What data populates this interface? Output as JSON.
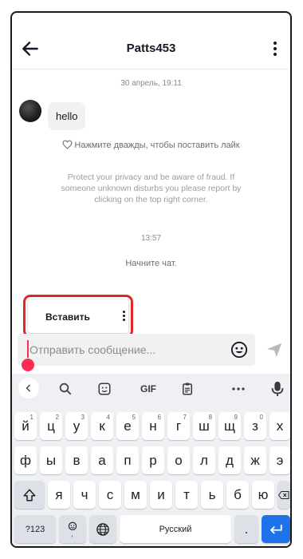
{
  "header": {
    "title": "Patts453"
  },
  "chat": {
    "timestamp_1": "30 апрель, 19:11",
    "message_1": "hello",
    "like_hint": "Нажмите дважды, чтобы поставить лайк",
    "privacy_notice": "Protect your privacy and be aware of fraud. If someone unknown disturbs you please report by clicking on the top right corner.",
    "timestamp_2": "13:57",
    "start_chat": "Начните чат."
  },
  "context_menu": {
    "paste_label": "Вставить"
  },
  "composer": {
    "placeholder": "Отправить сообщение..."
  },
  "keyboard": {
    "toolbar": {
      "gif_label": "GIF"
    },
    "row1": [
      {
        "k": "й",
        "h": "1"
      },
      {
        "k": "ц",
        "h": "2"
      },
      {
        "k": "у",
        "h": "3"
      },
      {
        "k": "к",
        "h": "4"
      },
      {
        "k": "е",
        "h": "5"
      },
      {
        "k": "н",
        "h": "6"
      },
      {
        "k": "г",
        "h": "7"
      },
      {
        "k": "ш",
        "h": "8"
      },
      {
        "k": "щ",
        "h": "9"
      },
      {
        "k": "з",
        "h": "0"
      },
      {
        "k": "х",
        "h": ""
      }
    ],
    "row2": [
      "ф",
      "ы",
      "в",
      "а",
      "п",
      "р",
      "о",
      "л",
      "д",
      "ж",
      "э"
    ],
    "row3": [
      "я",
      "ч",
      "с",
      "м",
      "и",
      "т",
      "ь",
      "б",
      "ю"
    ],
    "symbols_label": "?123",
    "space_label": "Русский",
    "period_label": "."
  },
  "colors": {
    "accent": "#fe2c55",
    "highlight_border": "#e0262b",
    "enter_key": "#1f73e8"
  }
}
